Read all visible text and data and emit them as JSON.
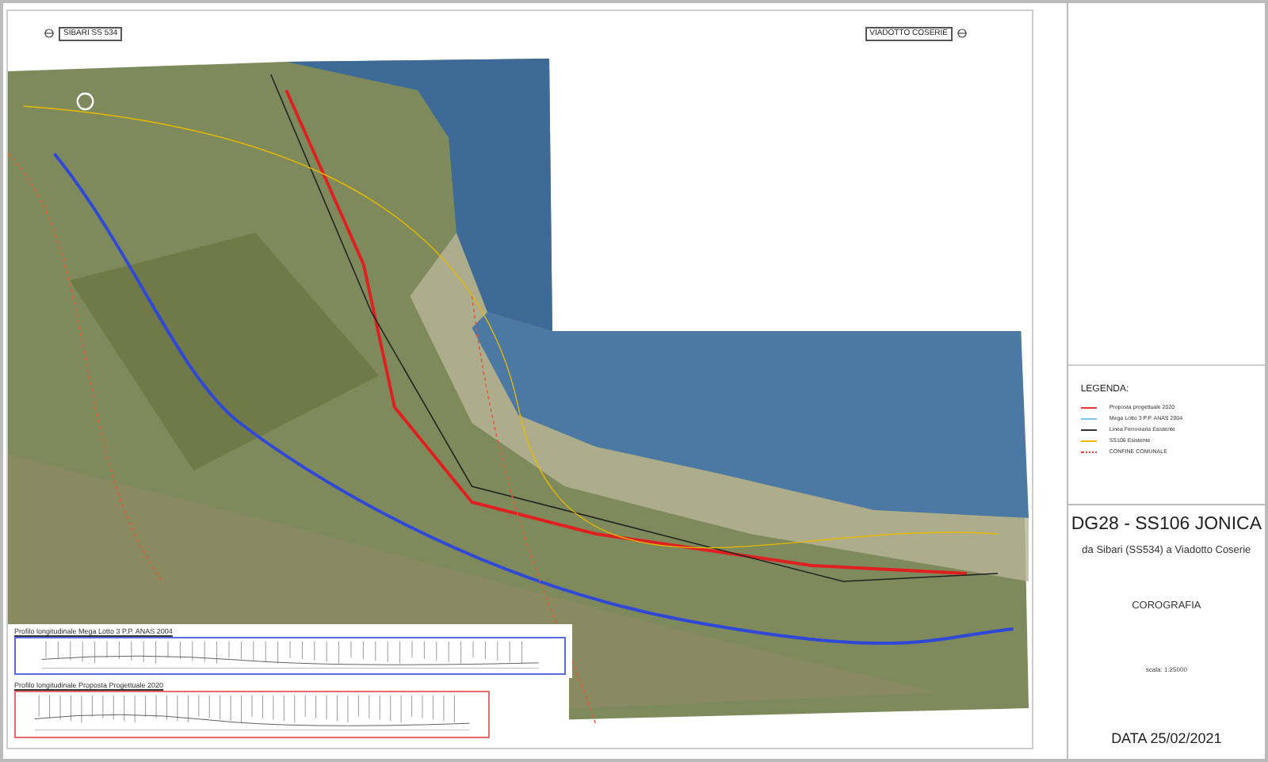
{
  "sheet": {
    "start_label": "SIBARI SS 534",
    "end_label": "VIADOTTO COSERIE"
  },
  "profiles": [
    {
      "title": "Profilo longitudinale Mega Lotto 3 P.P. ANAS 2004",
      "color": "#5b6be0"
    },
    {
      "title": "Profilo longitudinale Proposta Progettuale 2020",
      "color": "#e86a6a"
    }
  ],
  "legend": {
    "title": "LEGENDA:",
    "items": [
      {
        "label": "Proposta progettuale 2020",
        "kind": "line",
        "color": "#e53935"
      },
      {
        "label": "Mega Lotto 3 P.P. ANAS 2004",
        "kind": "line",
        "color": "#7cc4f2"
      },
      {
        "label": "Linea Ferroviaria Esistente",
        "kind": "line",
        "color": "#333333"
      },
      {
        "label": "SS106 Esistente",
        "kind": "line",
        "color": "#f5b800"
      },
      {
        "label": "CONFINE COMUNALE",
        "kind": "dotted",
        "color": "#e53935"
      }
    ]
  },
  "title_block": {
    "code": "DG28 - SS106 JONICA",
    "subtitle": "da Sibari (SS534) a Viadotto Coserie",
    "drawing": "COROGRAFIA",
    "scale": "scala: 1:25000",
    "date": "DATA 25/02/2021"
  }
}
